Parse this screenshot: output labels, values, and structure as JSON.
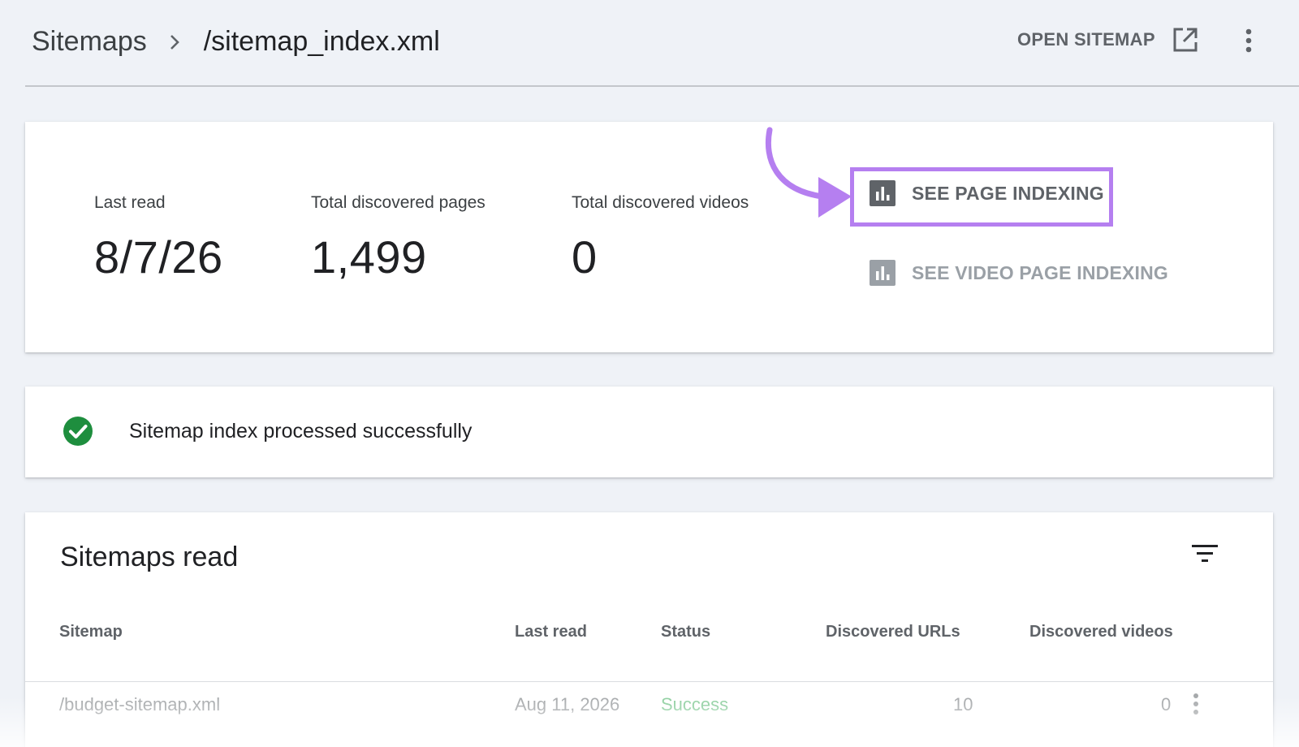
{
  "header": {
    "breadcrumb_root": "Sitemaps",
    "breadcrumb_current": "/sitemap_index.xml",
    "open_sitemap_label": "OPEN SITEMAP"
  },
  "stats": {
    "last_read": {
      "label": "Last read",
      "value": "8/7/26"
    },
    "total_pages": {
      "label": "Total discovered pages",
      "value": "1,499"
    },
    "total_videos": {
      "label": "Total discovered videos",
      "value": "0"
    }
  },
  "actions": {
    "page_indexing_label": "SEE PAGE INDEXING",
    "video_page_indexing_label": "SEE VIDEO PAGE INDEXING"
  },
  "status": {
    "message": "Sitemap index processed successfully",
    "icon": "check-circle-icon"
  },
  "table": {
    "title": "Sitemaps read",
    "columns": [
      "Sitemap",
      "Last read",
      "Status",
      "Discovered URLs",
      "Discovered videos"
    ],
    "rows": [
      {
        "sitemap": "/budget-sitemap.xml",
        "last_read": "Aug 11, 2026",
        "status": "Success",
        "discovered_urls": "10",
        "discovered_videos": "0"
      }
    ]
  },
  "colors": {
    "background": "#eff2f7",
    "highlight": "#b57ff0",
    "arrow": "#b57ff0",
    "success": "#1e8e3e",
    "muted": "#5f6368"
  }
}
